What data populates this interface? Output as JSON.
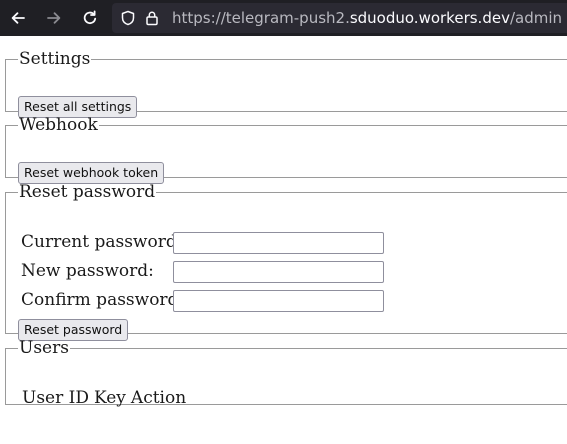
{
  "browser": {
    "url_prefix": "https://telegram-push2.",
    "url_host": "sduoduo.workers.dev",
    "url_suffix": "/admin",
    "icons": [
      "back-icon",
      "forward-icon",
      "reload-icon",
      "shield-icon",
      "lock-icon"
    ]
  },
  "settings": {
    "legend": "Settings",
    "reset_all_label": "Reset all settings"
  },
  "webhook": {
    "legend": "Webhook",
    "reset_token_label": "Reset webhook token"
  },
  "reset_password": {
    "legend": "Reset password",
    "current_label": "Current password:",
    "current_value": "",
    "new_label": "New password:",
    "new_value": "",
    "confirm_label": "Confirm password:",
    "confirm_value": "",
    "submit_label": "Reset password"
  },
  "users": {
    "legend": "Users",
    "columns": [
      "User ID",
      "Key",
      "Action"
    ]
  }
}
